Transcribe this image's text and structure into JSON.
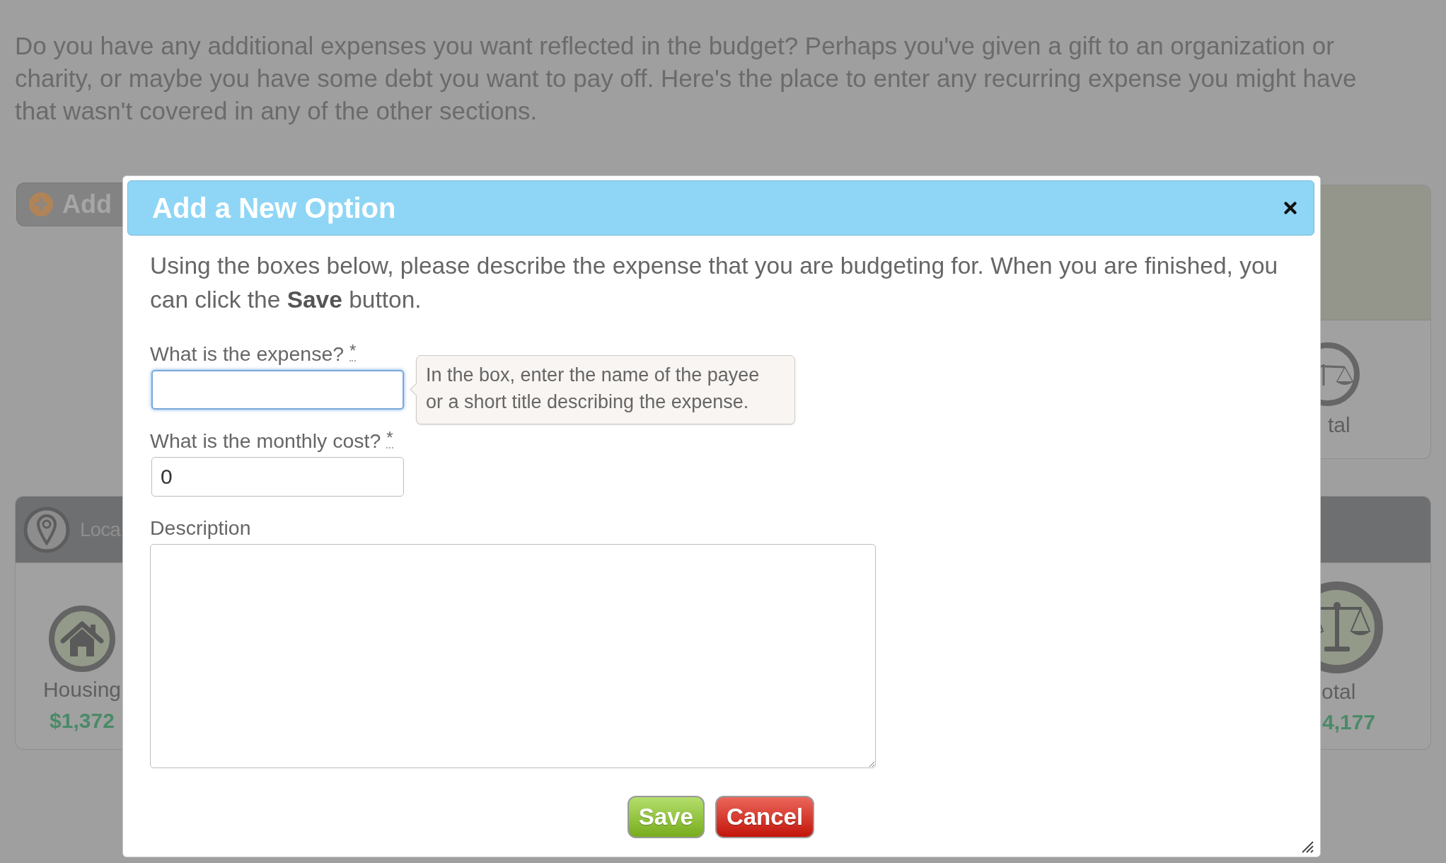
{
  "background_page": {
    "intro": "Do you have any additional expenses you want reflected in the budget? Perhaps you've given a gift to an organization or charity, or maybe you have some debt you want to pay off. Here's the place to enter any recurring expense you might have that wasn't covered in any of the other sections.",
    "add_button": {
      "label": "Add"
    },
    "left_panel": {
      "header": "Loca",
      "category": "Housing",
      "amount": "$1,372"
    },
    "right_top_panel": {
      "label": "tal"
    },
    "right_bottom_panel": {
      "label": "otal",
      "amount": "4,177"
    }
  },
  "dialog": {
    "title": "Add a New Option",
    "instructions": "Using the boxes below, please describe the expense that you are budgeting for. When you are finished, you can click the **Save** button.",
    "fields": [
      {
        "kind": "input",
        "label": "What is the expense?",
        "required_mark": "*",
        "focused": true,
        "tooltip": "In the box, enter the name of the payee or a short title describing the expense."
      },
      {
        "kind": "input",
        "label": "What is the monthly cost?",
        "required_mark": "*",
        "focused": false,
        "value": "0"
      },
      {
        "kind": "textarea",
        "label": "Description",
        "focused": false
      }
    ],
    "buttons": [
      {
        "kind": "save",
        "label": "Save"
      },
      {
        "kind": "cancel",
        "label": "Cancel"
      }
    ]
  }
}
